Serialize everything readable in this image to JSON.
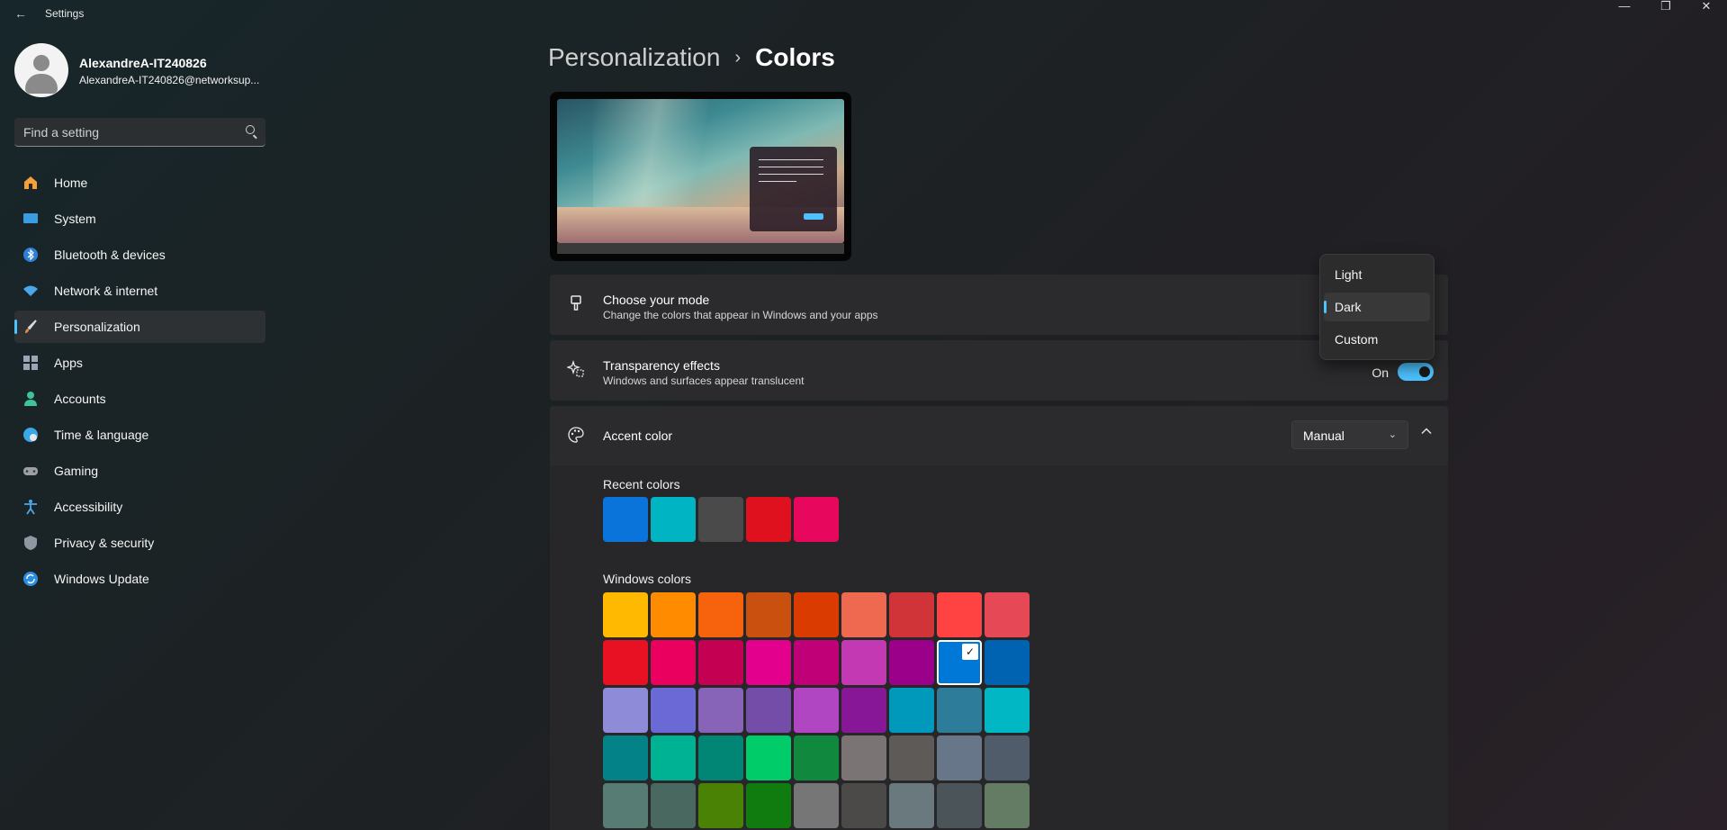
{
  "window": {
    "title": "Settings",
    "back": "←",
    "minimize": "—",
    "maximize": "❐",
    "close": "✕"
  },
  "profile": {
    "name": "AlexandreA-IT240826",
    "email": "AlexandreA-IT240826@networksup..."
  },
  "search": {
    "placeholder": "Find a setting"
  },
  "nav": [
    {
      "label": "Home",
      "icon": "home-icon",
      "color": "#f4a03b"
    },
    {
      "label": "System",
      "icon": "system-icon",
      "color": "#3a9de0"
    },
    {
      "label": "Bluetooth & devices",
      "icon": "bluetooth-icon",
      "color": "#2d7fd6"
    },
    {
      "label": "Network & internet",
      "icon": "wifi-icon",
      "color": "#4aa8e8"
    },
    {
      "label": "Personalization",
      "icon": "brush-icon",
      "color": "#e08a4a",
      "selected": true
    },
    {
      "label": "Apps",
      "icon": "apps-icon",
      "color": "#9aa6b4"
    },
    {
      "label": "Accounts",
      "icon": "accounts-icon",
      "color": "#3ec39a"
    },
    {
      "label": "Time & language",
      "icon": "globe-icon",
      "color": "#3aa7e6"
    },
    {
      "label": "Gaming",
      "icon": "gamepad-icon",
      "color": "#9aa0a6"
    },
    {
      "label": "Accessibility",
      "icon": "accessibility-icon",
      "color": "#4aa8e8"
    },
    {
      "label": "Privacy & security",
      "icon": "shield-icon",
      "color": "#8e98a3"
    },
    {
      "label": "Windows Update",
      "icon": "update-icon",
      "color": "#2d8ee0"
    }
  ],
  "breadcrumb": {
    "parent": "Personalization",
    "separator": "›",
    "current": "Colors"
  },
  "mode_card": {
    "title": "Choose your mode",
    "subtitle": "Change the colors that appear in Windows and your apps",
    "icon": "brush-icon"
  },
  "transparency_card": {
    "title": "Transparency effects",
    "subtitle": "Windows and surfaces appear translucent",
    "toggle_label": "On",
    "toggle_on": true,
    "icon": "sparkle-icon"
  },
  "accent_card": {
    "title": "Accent color",
    "select_value": "Manual",
    "icon": "palette-icon"
  },
  "recent_colors": {
    "label": "Recent colors",
    "colors": [
      "#0a74da",
      "#00b4c4",
      "#4a4a4a",
      "#e0111e",
      "#e7085d"
    ]
  },
  "windows_colors": {
    "label": "Windows colors",
    "selected_index": 16,
    "colors": [
      "#ffb900",
      "#ff8c00",
      "#f7630c",
      "#ca5010",
      "#da3b01",
      "#ef6950",
      "#d13438",
      "#ff4343",
      "#e74856",
      "#e81123",
      "#ea005e",
      "#c30052",
      "#e3008c",
      "#bf0077",
      "#c239b3",
      "#9a0089",
      "#0078d7",
      "#0063b1",
      "#8e8cd8",
      "#6b69d6",
      "#8764b8",
      "#744da9",
      "#b146c2",
      "#881798",
      "#0099bc",
      "#2d7d9a",
      "#00b7c3",
      "#038387",
      "#00b294",
      "#018574",
      "#00cc6a",
      "#10893e",
      "#7a7574",
      "#5d5a58",
      "#68768a",
      "#515c6b",
      "#567c73",
      "#486860",
      "#498205",
      "#107c10",
      "#767676",
      "#4c4a48",
      "#69797e",
      "#4a5459",
      "#647c64"
    ]
  },
  "mode_menu": {
    "options": [
      "Light",
      "Dark",
      "Custom"
    ],
    "selected": "Dark"
  }
}
